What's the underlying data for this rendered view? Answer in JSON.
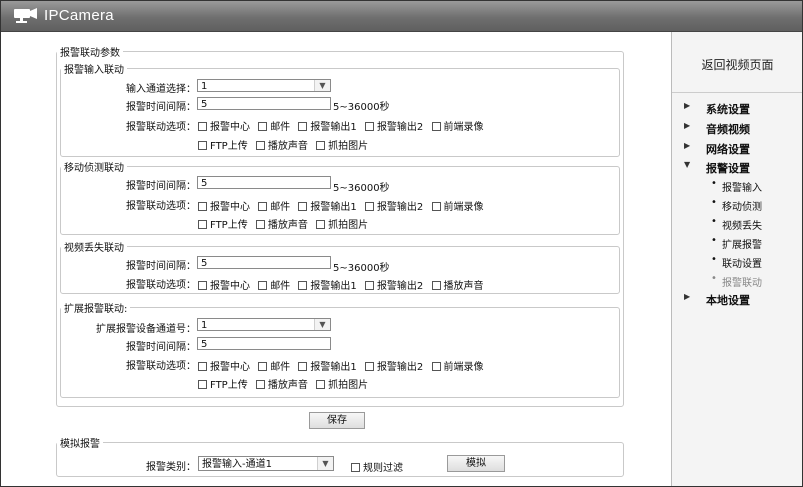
{
  "app": {
    "title": "IPCamera"
  },
  "sidebar": {
    "return_label": "返回视频页面",
    "menu": [
      {
        "label": "系统设置",
        "expanded": false
      },
      {
        "label": "音频视频",
        "expanded": false
      },
      {
        "label": "网络设置",
        "expanded": false
      },
      {
        "label": "报警设置",
        "expanded": true
      },
      {
        "label": "本地设置",
        "expanded": false
      }
    ],
    "alarm_sub": [
      "报警输入",
      "移动侦测",
      "视频丢失",
      "扩展报警",
      "联动设置",
      "报警联动"
    ],
    "active_sub": "报警联动"
  },
  "linkage": {
    "legend": "报警联动参数",
    "alarm_input": {
      "legend": "报警输入联动",
      "channel_label": "输入通道选择：",
      "channel_value": "1",
      "interval_label": "报警时间间隔：",
      "interval_value": "5",
      "interval_hint": "5~36000秒",
      "options_label": "报警联动选项：",
      "options_row1": [
        "报警中心",
        "邮件",
        "报警输出1",
        "报警输出2",
        "前端录像"
      ],
      "options_row2": [
        "FTP上传",
        "播放声音",
        "抓拍图片"
      ]
    },
    "motion": {
      "legend": "移动侦测联动",
      "interval_label": "报警时间间隔：",
      "interval_value": "5",
      "interval_hint": "5~36000秒",
      "options_label": "报警联动选项：",
      "options_row1": [
        "报警中心",
        "邮件",
        "报警输出1",
        "报警输出2",
        "前端录像"
      ],
      "options_row2": [
        "FTP上传",
        "播放声音",
        "抓拍图片"
      ]
    },
    "video_loss": {
      "legend": "视频丢失联动",
      "interval_label": "报警时间间隔：",
      "interval_value": "5",
      "interval_hint": "5~36000秒",
      "options_label": "报警联动选项：",
      "options_row1": [
        "报警中心",
        "邮件",
        "报警输出1",
        "报警输出2",
        "播放声音"
      ]
    },
    "ext_alarm": {
      "legend": "扩展报警联动:",
      "channel_label": "扩展报警设备通道号：",
      "channel_value": "1",
      "interval_label": "报警时间间隔：",
      "interval_value": "5",
      "options_label": "报警联动选项：",
      "options_row1": [
        "报警中心",
        "邮件",
        "报警输出1",
        "报警输出2",
        "前端录像"
      ],
      "options_row2": [
        "FTP上传",
        "播放声音",
        "抓拍图片"
      ]
    },
    "save_label": "保存"
  },
  "simulate": {
    "legend": "模拟报警",
    "type_label": "报警类别：",
    "type_value": "报警输入-通道1",
    "filter_label": "规则过滤",
    "button_label": "模拟"
  }
}
